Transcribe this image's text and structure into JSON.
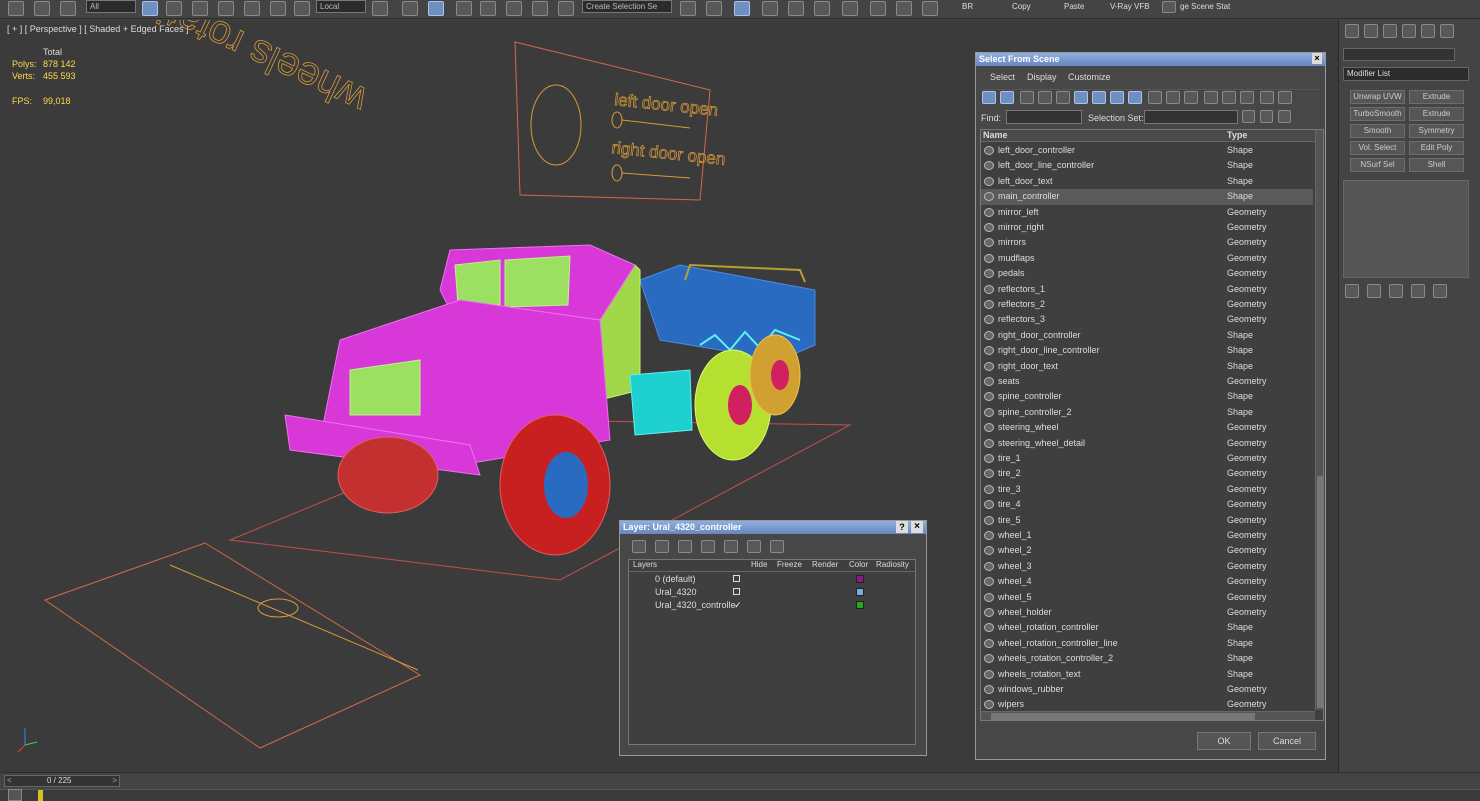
{
  "toolbar": {
    "filter_dropdown": "All",
    "coord_dropdown": "Local",
    "selection_set_placeholder": "Create Selection Se",
    "labels": [
      "BR",
      "Copy",
      "Paste",
      "V-Ray VFB",
      "ge Scene Stat"
    ]
  },
  "viewport": {
    "label": "[ + ] [ Perspective ] [ Shaded + Edged Faces ]",
    "stats": {
      "total_label": "Total",
      "polys_label": "Polys:",
      "polys_value": "878 142",
      "verts_label": "Verts:",
      "verts_value": "455 593",
      "fps_label": "FPS:",
      "fps_value": "99,018"
    },
    "sign_text_1": "left door open",
    "sign_text_2": "right door open",
    "floor_text": "wheels rotation"
  },
  "select_dialog": {
    "title": "Select From Scene",
    "menus": [
      "Select",
      "Display",
      "Customize"
    ],
    "find_label": "Find:",
    "selection_set_label": "Selection Set:",
    "col_name": "Name",
    "col_type": "Type",
    "rows": [
      {
        "name": "left_door_controller",
        "type": "Shape"
      },
      {
        "name": "left_door_line_controller",
        "type": "Shape"
      },
      {
        "name": "left_door_text",
        "type": "Shape"
      },
      {
        "name": "main_controller",
        "type": "Shape"
      },
      {
        "name": "mirror_left",
        "type": "Geometry"
      },
      {
        "name": "mirror_right",
        "type": "Geometry"
      },
      {
        "name": "mirrors",
        "type": "Geometry"
      },
      {
        "name": "mudflaps",
        "type": "Geometry"
      },
      {
        "name": "pedals",
        "type": "Geometry"
      },
      {
        "name": "reflectors_1",
        "type": "Geometry"
      },
      {
        "name": "reflectors_2",
        "type": "Geometry"
      },
      {
        "name": "reflectors_3",
        "type": "Geometry"
      },
      {
        "name": "right_door_controller",
        "type": "Shape"
      },
      {
        "name": "right_door_line_controller",
        "type": "Shape"
      },
      {
        "name": "right_door_text",
        "type": "Shape"
      },
      {
        "name": "seats",
        "type": "Geometry"
      },
      {
        "name": "spine_controller",
        "type": "Shape"
      },
      {
        "name": "spine_controller_2",
        "type": "Shape"
      },
      {
        "name": "steering_wheel",
        "type": "Geometry"
      },
      {
        "name": "steering_wheel_detail",
        "type": "Geometry"
      },
      {
        "name": "tire_1",
        "type": "Geometry"
      },
      {
        "name": "tire_2",
        "type": "Geometry"
      },
      {
        "name": "tire_3",
        "type": "Geometry"
      },
      {
        "name": "tire_4",
        "type": "Geometry"
      },
      {
        "name": "tire_5",
        "type": "Geometry"
      },
      {
        "name": "wheel_1",
        "type": "Geometry"
      },
      {
        "name": "wheel_2",
        "type": "Geometry"
      },
      {
        "name": "wheel_3",
        "type": "Geometry"
      },
      {
        "name": "wheel_4",
        "type": "Geometry"
      },
      {
        "name": "wheel_5",
        "type": "Geometry"
      },
      {
        "name": "wheel_holder",
        "type": "Geometry"
      },
      {
        "name": "wheel_rotation_controller",
        "type": "Shape"
      },
      {
        "name": "wheel_rotation_controller_line",
        "type": "Shape"
      },
      {
        "name": "wheels_rotation_controller_2",
        "type": "Shape"
      },
      {
        "name": "wheels_rotation_text",
        "type": "Shape"
      },
      {
        "name": "windows_rubber",
        "type": "Geometry"
      },
      {
        "name": "wipers",
        "type": "Geometry"
      }
    ],
    "ok_label": "OK",
    "cancel_label": "Cancel"
  },
  "layer_dialog": {
    "title": "Layer: Ural_4320_controller",
    "help": "?",
    "close": "×",
    "columns": [
      "Layers",
      "Hide",
      "Freeze",
      "Render",
      "Color",
      "Radiosity"
    ],
    "rows": [
      {
        "name": "0 (default)",
        "color": "#8a1a8a"
      },
      {
        "name": "Ural_4320",
        "color": "#7fa7d8"
      },
      {
        "name": "Ural_4320_controlle",
        "color": "#22a822"
      }
    ]
  },
  "command_panel": {
    "modifier_list": "Modifier List",
    "buttons": [
      "Unwrap UVW",
      "Extrude",
      "TurboSmooth",
      "Extrude",
      "Smooth",
      "Symmetry",
      "Vol. Select",
      "Edit Poly",
      "NSurf Sel",
      "Shell"
    ]
  },
  "timeline": {
    "frame_counter": "0 / 225"
  }
}
